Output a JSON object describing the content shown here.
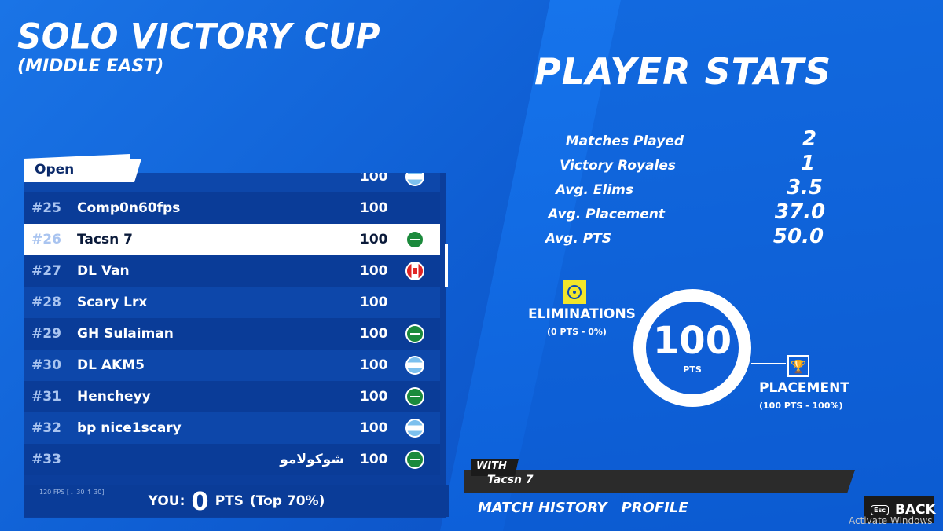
{
  "header": {
    "title": "SOLO VICTORY CUP",
    "subtitle": "(MIDDLE EAST)",
    "stats_title": "PLAYER STATS"
  },
  "leaderboard": {
    "tab_label": "Open",
    "rows": [
      {
        "rank": "",
        "name": "",
        "pts": "100",
        "flag": "ar"
      },
      {
        "rank": "#25",
        "name": "Comp0n60fps",
        "pts": "100",
        "flag": "none"
      },
      {
        "rank": "#26",
        "name": "Tacsn 7",
        "pts": "100",
        "flag": "sa",
        "selected": true
      },
      {
        "rank": "#27",
        "name": "DL Van",
        "pts": "100",
        "flag": "ca"
      },
      {
        "rank": "#28",
        "name": "Scary Lrx",
        "pts": "100",
        "flag": "none"
      },
      {
        "rank": "#29",
        "name": "GH Sulaiman",
        "pts": "100",
        "flag": "sa"
      },
      {
        "rank": "#30",
        "name": "DL AKM5",
        "pts": "100",
        "flag": "ar"
      },
      {
        "rank": "#31",
        "name": "Henchеyy",
        "pts": "100",
        "flag": "sa"
      },
      {
        "rank": "#32",
        "name": "bp nice1scary",
        "pts": "100",
        "flag": "ar"
      },
      {
        "rank": "#33",
        "name": "شوكولامو",
        "pts": "100",
        "flag": "sa",
        "rtl": true
      }
    ],
    "fps_text": "120 FPS [↓ 30 ↑ 30]",
    "you": {
      "label": "YOU:",
      "points": "0",
      "pts_label": "PTS",
      "rank_text": "(Top 70%)"
    }
  },
  "stats": {
    "items": [
      {
        "label": "Matches Played",
        "value": "2"
      },
      {
        "label": "Victory Royales",
        "value": "1"
      },
      {
        "label": "Avg. Elims",
        "value": "3.5"
      },
      {
        "label": "Avg. Placement",
        "value": "37.0"
      },
      {
        "label": "Avg. PTS",
        "value": "50.0"
      }
    ],
    "total_points": "100",
    "total_unit": "PTS",
    "eliminations_label": "ELIMINATIONS",
    "eliminations_sub": "(0 PTS - 0%)",
    "placement_label": "PLACEMENT",
    "placement_sub": "(100 PTS - 100%)"
  },
  "footer": {
    "with_label": "WITH",
    "with_name": "Tacsn 7",
    "nav": [
      "MATCH HISTORY",
      "PROFILE"
    ],
    "esc_label": "Esc",
    "back_label": "BACK",
    "watermark": "Activate Windows"
  }
}
